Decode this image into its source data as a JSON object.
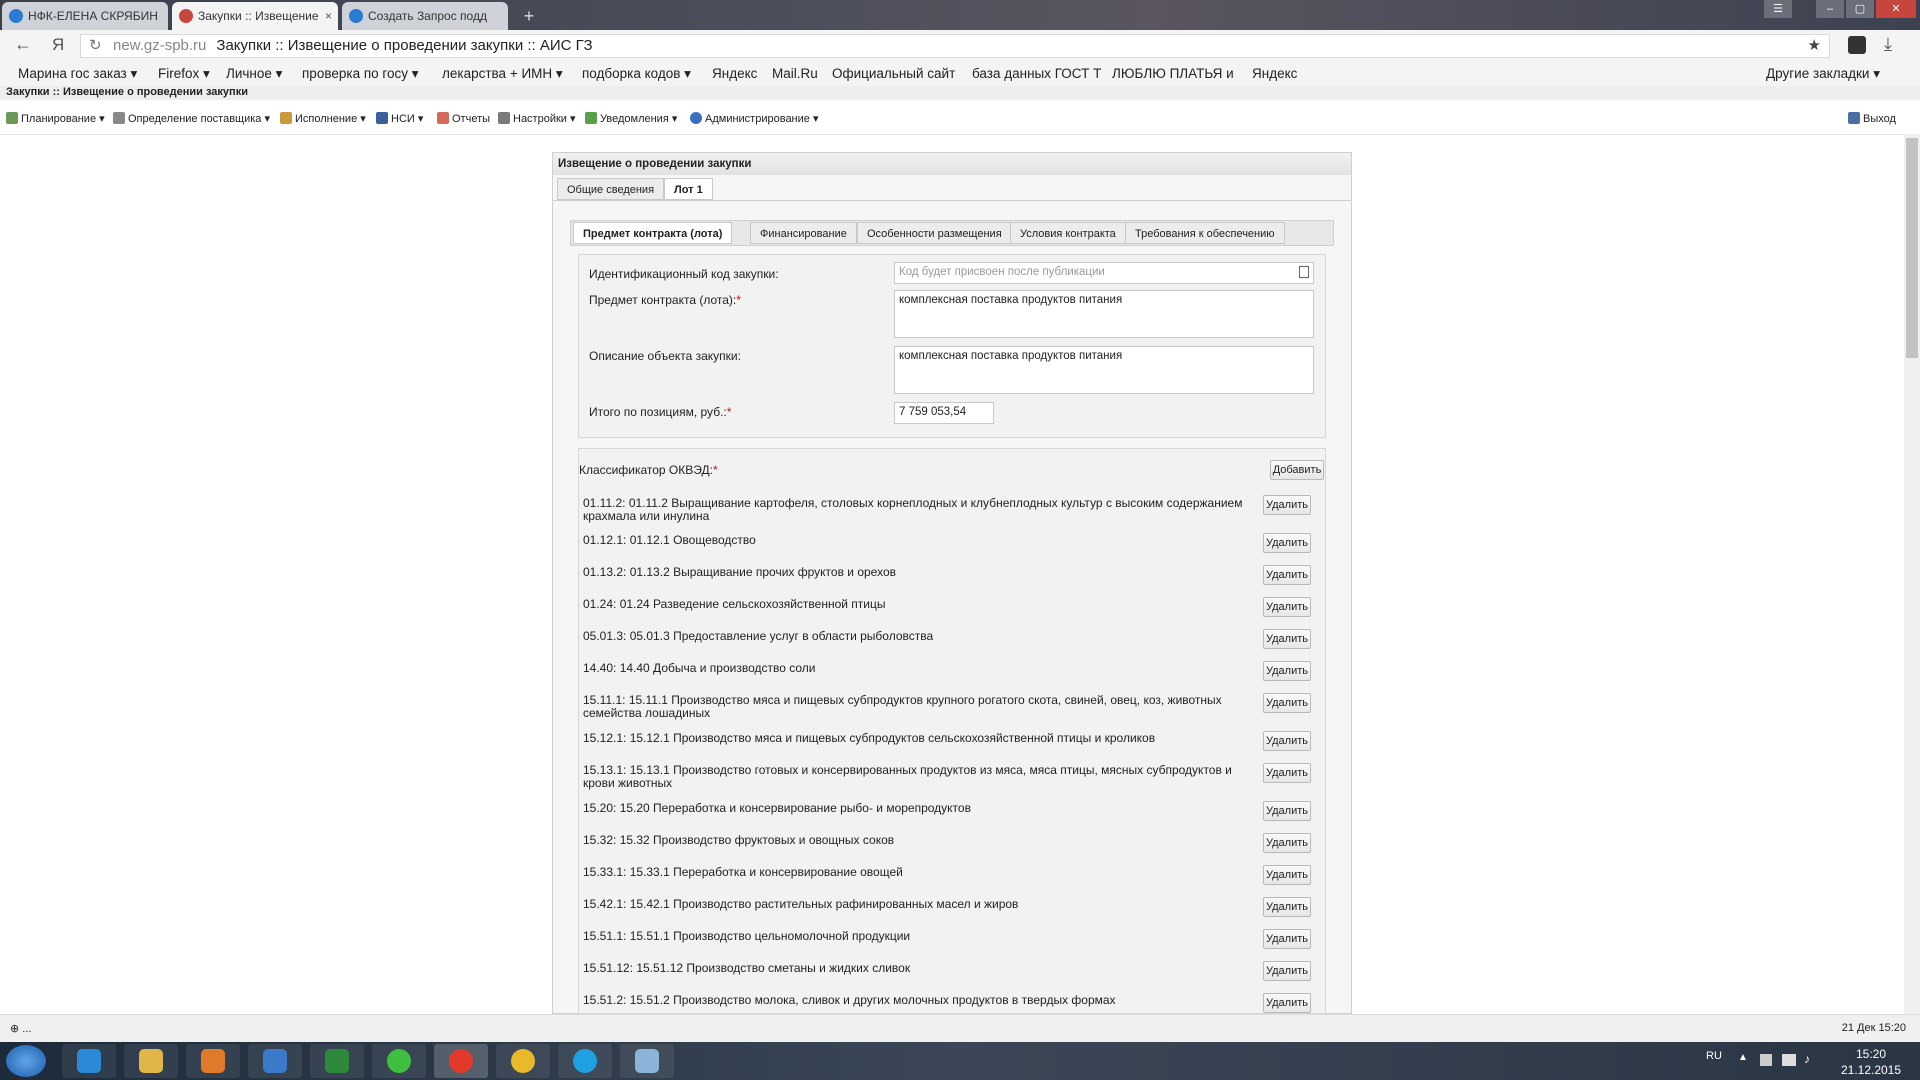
{
  "browser": {
    "tabs": [
      {
        "label": "НФК-ЕЛЕНА СКРЯБИН"
      },
      {
        "label": "Закупки :: Извещение",
        "close": "×"
      },
      {
        "label": "Создать Запрос подд"
      }
    ],
    "new_tab": "+",
    "window_buttons": [
      "☰",
      "–",
      "▢",
      "✕"
    ],
    "url_host": "new.gz-spb.ru",
    "url_title": "Закупки :: Извещение о проведении закупки :: АИС ГЗ",
    "star": "★",
    "bookmarks": [
      "Марина гос заказ ▾",
      "Firefox ▾",
      "Личное ▾",
      "проверка по госу ▾",
      "лекарства + ИМН ▾",
      "подборка кодов ▾",
      "Яндекс",
      "Mail.Ru",
      "Официальный сайт",
      "база данных ГОСТ Т",
      "ЛЮБЛЮ ПЛАТЬЯ и",
      "Яндекс"
    ],
    "other_bookmarks": "Другие закладки ▾"
  },
  "page_header": "Закупки :: Извещение о проведении закупки",
  "app_menu": {
    "items": [
      "Планирование ▾",
      "Определение поставщика ▾",
      "Исполнение ▾",
      "НСИ ▾",
      "Отчеты",
      "Настройки ▾",
      "Уведомления ▾",
      "Администрирование ▾"
    ],
    "logout": "Выход"
  },
  "panel": {
    "title": "Извещение о проведении закупки",
    "tabs": [
      "Общие сведения",
      "Лот 1"
    ],
    "inner_tabs": [
      "Предмет контракта (лота)",
      "Финансирование",
      "Особенности размещения",
      "Условия контракта",
      "Требования к обеспечению"
    ]
  },
  "fields": {
    "id_code_label": "Идентификационный код закупки:",
    "id_code_placeholder": "Код будет присвоен после публикации",
    "subject_label": "Предмет контракта (лота):",
    "subject_value": "комплексная поставка продуктов питания",
    "description_label": "Описание объекта закупки:",
    "description_value": "комплексная поставка продуктов питания",
    "total_label": "Итого по позициям, руб.:",
    "total_value": "7 759 053,54",
    "required_mark": "*"
  },
  "okved": {
    "label": "Классификатор ОКВЭД:",
    "add_button": "Добавить",
    "delete_button": "Удалить",
    "items": [
      "01.11.2: 01.11.2 Выращивание картофеля, столовых корнеплодных и клубнеплодных культур с высоким содержанием крахмала или инулина",
      "01.12.1: 01.12.1 Овощеводство",
      "01.13.2: 01.13.2 Выращивание прочих фруктов и орехов",
      "01.24: 01.24 Разведение сельскохозяйственной птицы",
      "05.01.3: 05.01.3 Предоставление услуг в области рыболовства",
      "14.40: 14.40 Добыча и производство соли",
      "15.11.1: 15.11.1 Производство мяса и пищевых субпродуктов крупного рогатого скота, свиней, овец, коз, животных семейства лошадиных",
      "15.12.1: 15.12.1 Производство мяса и пищевых субпродуктов сельскохозяйственной птицы и кроликов",
      "15.13.1: 15.13.1 Производство готовых и консервированных продуктов из мяса, мяса птицы, мясных субпродуктов и крови животных",
      "15.20: 15.20 Переработка и консервирование рыбо- и морепродуктов",
      "15.32: 15.32 Производство фруктовых и овощных соков",
      "15.33.1: 15.33.1 Переработка и консервирование овощей",
      "15.42.1: 15.42.1 Производство растительных рафинированных масел и жиров",
      "15.51.1: 15.51.1 Производство цельномолочной продукции",
      "15.51.12: 15.51.12 Производство сметаны и жидких сливок",
      "15.51.2: 15.51.2 Производство молока, сливок и других молочных продуктов в твердых формах"
    ]
  },
  "status": {
    "left": "⊕ ...",
    "right": "21 Дек 15:20"
  },
  "taskbar": {
    "lang": "RU",
    "time": "15:20",
    "date": "21.12.2015"
  }
}
